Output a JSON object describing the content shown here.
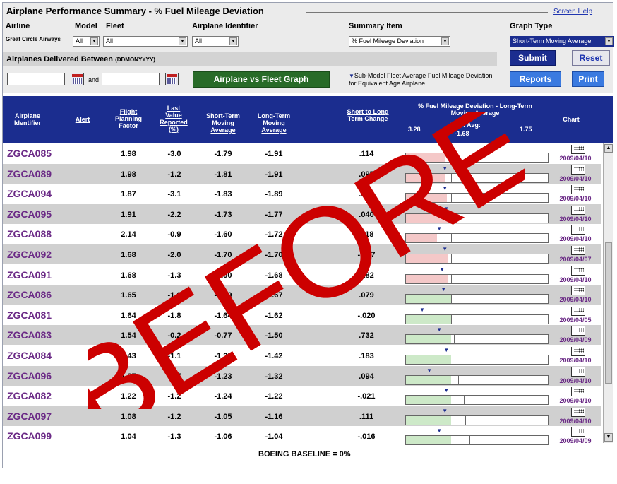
{
  "header": {
    "title": "Airplane Performance Summary - % Fuel Mileage Deviation",
    "screen_help": "Screen Help"
  },
  "filters": {
    "airline_label": "Airline",
    "model_label": "Model",
    "fleet_label": "Fleet",
    "airplane_id_label": "Airplane Identifier",
    "summary_item_label": "Summary Item",
    "graph_type_label": "Graph Type",
    "airline_value": "Great Circle Airways",
    "model_value": "All",
    "fleet_value": "All",
    "airplane_id_value": "All",
    "summary_item_value": "% Fuel Mileage Deviation",
    "graph_type_value": "Short-Term Moving Average"
  },
  "delivered": {
    "label": "Airplanes Delivered Between",
    "format": "(DDMONYYYY)",
    "and_label": "and",
    "from_value": "",
    "to_value": ""
  },
  "actions": {
    "fleet_graph": "Airplane vs Fleet Graph",
    "submodel_note": "Sub-Model Fleet Average Fuel Mileage Deviation for Equivalent Age Airplane",
    "submit": "Submit",
    "reset": "Reset",
    "reports": "Reports",
    "print": "Print"
  },
  "columns": {
    "airplane_identifier": "Airplane Identifier",
    "alert": "Alert",
    "flight_planning_factor": "Flight Planning Factor",
    "last_value_reported": "Last Value Reported (%)",
    "short_term": "Short-Term Moving Average",
    "long_term": "Long-Term Moving Average",
    "short_to_long": "Short to Long Term Change",
    "deviation_title": "% Fuel Mileage Deviation - Long-Term Moving Average",
    "scale_min": "3.28",
    "fleet_avg_label": "Fleet Avg:",
    "fleet_avg_value": "-1.68",
    "scale_max": "1.75",
    "chart": "Chart"
  },
  "rows": [
    {
      "id": "ZGCA085",
      "fpf": "1.98",
      "last": "-3.0",
      "st": "-1.79",
      "lt": "-1.91",
      "chg": ".114",
      "date": "2009/04/10",
      "fill": 0.28,
      "fill_color": "pink",
      "mark": 0.32,
      "arrow": 0.26
    },
    {
      "id": "ZGCA089",
      "fpf": "1.98",
      "last": "-1.2",
      "st": "-1.81",
      "lt": "-1.91",
      "chg": ".095",
      "date": "2009/04/10",
      "fill": 0.28,
      "fill_color": "pink",
      "mark": 0.32,
      "arrow": 0.26
    },
    {
      "id": "ZGCA094",
      "fpf": "1.87",
      "last": "-3.1",
      "st": "-1.83",
      "lt": "-1.89",
      "chg": ".052",
      "date": "2009/04/10",
      "fill": 0.29,
      "fill_color": "pink",
      "mark": 0.32,
      "arrow": 0.26
    },
    {
      "id": "ZGCA095",
      "fpf": "1.91",
      "last": "-2.2",
      "st": "-1.73",
      "lt": "-1.77",
      "chg": ".040",
      "date": "2009/04/10",
      "fill": 0.3,
      "fill_color": "pink",
      "mark": 0.32,
      "arrow": 0.27
    },
    {
      "id": "ZGCA088",
      "fpf": "2.14",
      "last": "-0.9",
      "st": "-1.60",
      "lt": "-1.72",
      "chg": ".118",
      "date": "2009/04/10",
      "fill": 0.22,
      "fill_color": "pink",
      "mark": 0.32,
      "arrow": 0.22
    },
    {
      "id": "ZGCA092",
      "fpf": "1.68",
      "last": "-2.0",
      "st": "-1.70",
      "lt": "-1.70",
      "chg": "-.007",
      "date": "2009/04/07",
      "fill": 0.3,
      "fill_color": "pink",
      "mark": 0.32,
      "arrow": 0.26
    },
    {
      "id": "ZGCA091",
      "fpf": "1.68",
      "last": "-1.3",
      "st": "-1.50",
      "lt": "-1.68",
      "chg": ".182",
      "date": "2009/04/10",
      "fill": 0.3,
      "fill_color": "pink",
      "mark": 0.32,
      "arrow": 0.24
    },
    {
      "id": "ZGCA086",
      "fpf": "1.65",
      "last": "-1.0",
      "st": "-1.59",
      "lt": "-1.67",
      "chg": ".079",
      "date": "2009/04/10",
      "fill": 0.32,
      "fill_color": "green",
      "mark": 0.32,
      "arrow": 0.25
    },
    {
      "id": "ZGCA081",
      "fpf": "1.64",
      "last": "-1.8",
      "st": "-1.64",
      "lt": "-1.62",
      "chg": "-.020",
      "date": "2009/04/05",
      "fill": 0.32,
      "fill_color": "green",
      "mark": 0.32,
      "arrow": 0.1
    },
    {
      "id": "ZGCA083",
      "fpf": "1.54",
      "last": "-0.2",
      "st": "-0.77",
      "lt": "-1.50",
      "chg": ".732",
      "date": "2009/04/09",
      "fill": 0.32,
      "fill_color": "green",
      "mark": 0.34,
      "arrow": 0.22
    },
    {
      "id": "ZGCA084",
      "fpf": "1.43",
      "last": "-1.1",
      "st": "-1.23",
      "lt": "-1.42",
      "chg": ".183",
      "date": "2009/04/10",
      "fill": 0.32,
      "fill_color": "green",
      "mark": 0.36,
      "arrow": 0.27
    },
    {
      "id": "ZGCA096",
      "fpf": "1.27",
      "last": "-0.7",
      "st": "-1.23",
      "lt": "-1.32",
      "chg": ".094",
      "date": "2009/04/10",
      "fill": 0.32,
      "fill_color": "green",
      "mark": 0.37,
      "arrow": 0.15
    },
    {
      "id": "ZGCA082",
      "fpf": "1.22",
      "last": "-1.2",
      "st": "-1.24",
      "lt": "-1.22",
      "chg": "-.021",
      "date": "2009/04/10",
      "fill": 0.32,
      "fill_color": "green",
      "mark": 0.41,
      "arrow": 0.27
    },
    {
      "id": "ZGCA097",
      "fpf": "1.08",
      "last": "-1.2",
      "st": "-1.05",
      "lt": "-1.16",
      "chg": ".111",
      "date": "2009/04/10",
      "fill": 0.32,
      "fill_color": "green",
      "mark": 0.42,
      "arrow": 0.26
    },
    {
      "id": "ZGCA099",
      "fpf": "1.04",
      "last": "-1.3",
      "st": "-1.06",
      "lt": "-1.04",
      "chg": "-.016",
      "date": "2009/04/09",
      "fill": 0.32,
      "fill_color": "green",
      "mark": 0.45,
      "arrow": 0.22
    }
  ],
  "footer": {
    "baseline": "BOEING BASELINE = 0%"
  },
  "watermark": {
    "text": "BEFORE",
    "color": "#cc0000"
  }
}
